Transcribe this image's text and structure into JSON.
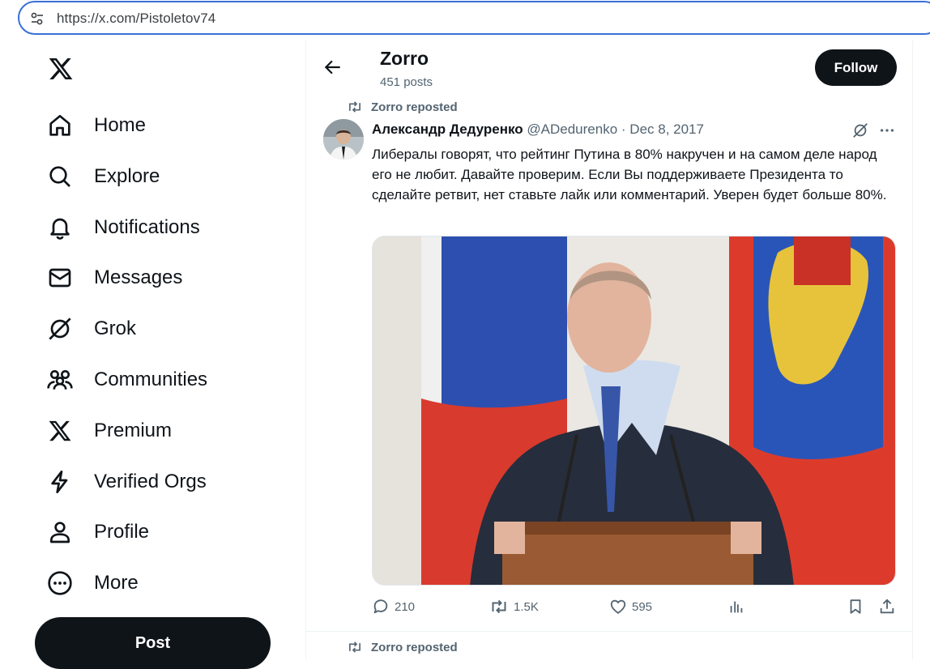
{
  "browser": {
    "url": "https://x.com/Pistoletov74"
  },
  "nav": {
    "items": [
      {
        "label": "Home",
        "icon": "home-icon"
      },
      {
        "label": "Explore",
        "icon": "search-icon"
      },
      {
        "label": "Notifications",
        "icon": "bell-icon"
      },
      {
        "label": "Messages",
        "icon": "envelope-icon"
      },
      {
        "label": "Grok",
        "icon": "grok-icon"
      },
      {
        "label": "Communities",
        "icon": "people-icon"
      },
      {
        "label": "Premium",
        "icon": "x-icon"
      },
      {
        "label": "Verified Orgs",
        "icon": "lightning-icon"
      },
      {
        "label": "Profile",
        "icon": "person-icon"
      },
      {
        "label": "More",
        "icon": "more-circle-icon"
      }
    ],
    "post_label": "Post"
  },
  "header": {
    "title": "Zorro",
    "subtitle": "451 posts",
    "follow_label": "Follow"
  },
  "tweets": [
    {
      "repost_label": "Zorro reposted",
      "author_name": "Александр Дедуренко",
      "author_handle": "@ADedurenko",
      "separator": "·",
      "date": "Dec 8, 2017",
      "text": "Либералы говорят, что рейтинг Путина в 80% накручен и на самом деле народ его не любит. Давайте проверим. Если Вы поддерживаете Президента то сделайте ретвит, нет ставьте лайк или комментарий. Уверен будет больше 80%.",
      "replies": "210",
      "reposts": "1.5K",
      "likes": "595"
    },
    {
      "repost_label": "Zorro reposted"
    }
  ],
  "colors": {
    "accent_blue": "#3a6fd8",
    "text_primary": "#0f1419",
    "text_secondary": "#536471",
    "button_dark": "#0f1419"
  }
}
